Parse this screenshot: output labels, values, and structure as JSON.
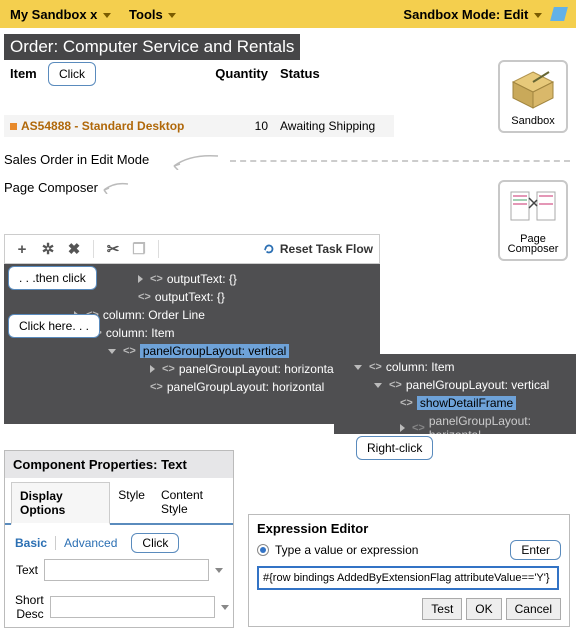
{
  "topbar": {
    "sandbox_menu": "My Sandbox x",
    "tools_menu": "Tools",
    "mode_label": "Sandbox Mode: Edit"
  },
  "order": {
    "title": "Order: Computer Service and Rentals",
    "columns": {
      "item": "Item",
      "qty": "Quantity",
      "status": "Status"
    },
    "row": {
      "item": "AS54888 - Standard Desktop",
      "qty": "10",
      "status": "Awaiting Shipping"
    }
  },
  "labels": {
    "sales_order": "Sales Order in Edit Mode",
    "page_composer": "Page Composer"
  },
  "callouts": {
    "item_click": "Click",
    "then_click": ". . .then click",
    "click_here": "Click here. . .",
    "right_click": "Right-click",
    "tabs_click": "Click",
    "enter": "Enter"
  },
  "toolbar": {
    "reset": "Reset Task Flow"
  },
  "tree": {
    "n1": "outputText: {}",
    "n2": "outputText: {}",
    "n3": "column: Order Line",
    "n4": "column: Item",
    "n5": "panelGroupLayout: vertical",
    "n6": "panelGroupLayout: horizontal",
    "n7": "panelGroupLayout: horizontal"
  },
  "small_tree": {
    "s1": "column: Item",
    "s2": "panelGroupLayout: vertical",
    "s3": "showDetailFrame",
    "s4": "panelGroupLayout: horizontal"
  },
  "icon_boxes": {
    "sandbox": "Sandbox",
    "page_composer_l1": "Page",
    "page_composer_l2": "Composer"
  },
  "props": {
    "title": "Component Properties: Text",
    "tabs": {
      "display": "Display Options",
      "style": "Style",
      "content_style": "Content Style"
    },
    "subtabs": {
      "basic": "Basic",
      "advanced": "Advanced"
    },
    "fields": {
      "text": "Text",
      "short_desc": "Short Desc"
    }
  },
  "expr": {
    "title": "Expression Editor",
    "radio_label": "Type a value or expression",
    "value": "#{row bindings AddedByExtensionFlag attributeValue=='Y'}",
    "buttons": {
      "test": "Test",
      "ok": "OK",
      "cancel": "Cancel"
    }
  }
}
